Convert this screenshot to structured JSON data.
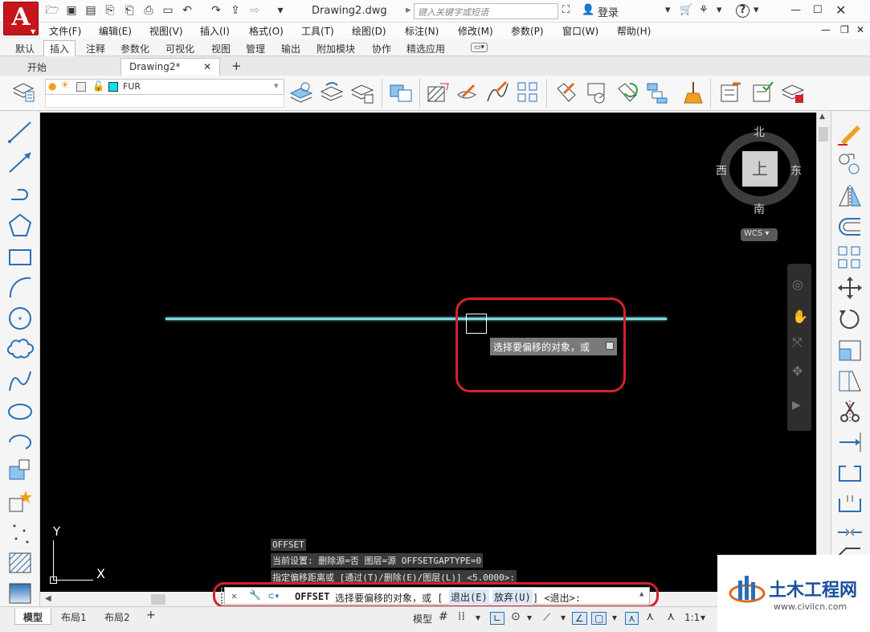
{
  "app": {
    "logo_letter": "A",
    "document_title": "Drawing2.dwg",
    "search_placeholder": "键入关键字或短语",
    "login_label": "登录",
    "help_glyph": "?"
  },
  "menus": [
    "文件(F)",
    "编辑(E)",
    "视图(V)",
    "插入(I)",
    "格式(O)",
    "工具(T)",
    "绘图(D)",
    "标注(N)",
    "修改(M)",
    "参数(P)",
    "窗口(W)",
    "帮助(H)"
  ],
  "ribbon_tabs": [
    "默认",
    "插入",
    "注释",
    "参数化",
    "可视化",
    "视图",
    "管理",
    "输出",
    "附加模块",
    "协作",
    "精选应用"
  ],
  "ribbon_active_tab": "插入",
  "file_tabs": [
    "开始",
    "Drawing2*"
  ],
  "layer": {
    "name": "FUR"
  },
  "viewcube": {
    "north": "北",
    "south": "南",
    "west": "西",
    "east": "东",
    "face": "上",
    "wcs": "WCS"
  },
  "tooltip": "选择要偏移的对象，或",
  "ucs": {
    "y": "Y",
    "x": "X"
  },
  "command_history": [
    "OFFSET",
    "当前设置: 删除源=否  图层=源  OFFSETGAPTYPE=0",
    "指定偏移距离或 [通过(T)/删除(E)/图层(L)] <5.0000>:"
  ],
  "command_line": {
    "command": "OFFSET",
    "prompt": "选择要偏移的对象，或 [",
    "opt1": "退出(E)",
    "opt2": "放弃(U)",
    "suffix": "] <退出>:"
  },
  "layout_tabs": [
    "模型",
    "布局1",
    "布局2"
  ],
  "status": {
    "model": "模型",
    "scale": "1:1"
  },
  "watermark": {
    "title": "土木工程网",
    "url": "www.civilcn.com"
  },
  "colors": {
    "line": "#7fd8e0",
    "highlight_box": "#d4222b",
    "canvas": "#000000"
  }
}
